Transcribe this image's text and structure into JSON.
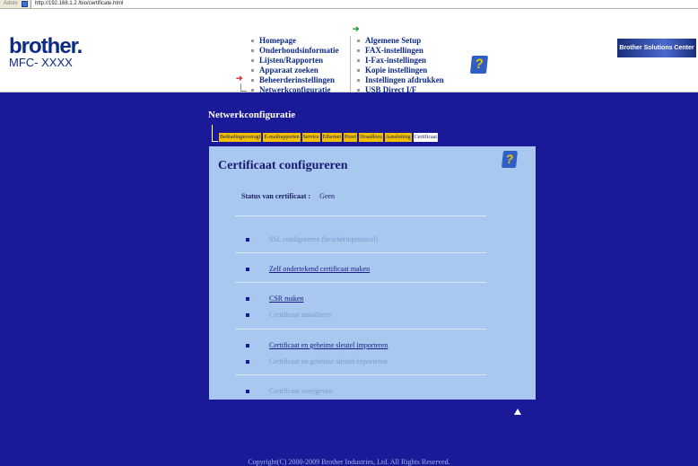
{
  "browser": {
    "address_label": "Adres",
    "url": "http://192.168.1.2 /bio/certificate.html"
  },
  "header": {
    "brand": "brother.",
    "model": "MFC- XXXX",
    "solutions_center": "Brother Solutions Center"
  },
  "nav_left": [
    "Homepage",
    "Onderhoudsinformatie",
    "Lijsten/Rapporten",
    "Apparaat zoeken",
    "Beheerderinstellingen",
    "Netwerkconfiguratie"
  ],
  "nav_right": [
    "Algemene Setup",
    "FAX-instellingen",
    "I-Fax-instellingen",
    "Kopie instellingen",
    "Instellingen afdrukken",
    "USB Direct I/F"
  ],
  "section": {
    "title": "Netwerkconfiguratie",
    "tabs": [
      "Bedradingsoveragt",
      "E-mailrapporten",
      "Service",
      "Ethernet",
      "Poort",
      "Draadloos",
      "Aansluiting",
      "Certificaat"
    ],
    "active_tab": "Certificaat"
  },
  "panel": {
    "title": "Certificaat configureren",
    "status_label": "Status van certificaat :",
    "status_value": "Geen",
    "links": [
      {
        "label": "SSL configureren (beschermprotocol)",
        "enabled": false
      },
      {
        "label": "Zelf ondertekend certificaat maken",
        "enabled": true
      },
      {
        "label": "CSR maken",
        "enabled": true
      },
      {
        "label": "Certificaat installeren",
        "enabled": false
      },
      {
        "label": "Certificaat en geheime sleutel importeren",
        "enabled": true
      },
      {
        "label": "Certificaat en geheime sleutel exporteren",
        "enabled": false
      },
      {
        "label": "Certificaat weergeven",
        "enabled": false
      }
    ]
  },
  "footer": {
    "copyright": "Copyright(C) 2000-2009 Brother Industries, Ltd. All Rights Reserved."
  },
  "colors": {
    "main_bg": "#1a1a99",
    "panel_bg": "#a8c8f0",
    "tab_bg": "#f0c000",
    "brand": "#0d2a87"
  }
}
